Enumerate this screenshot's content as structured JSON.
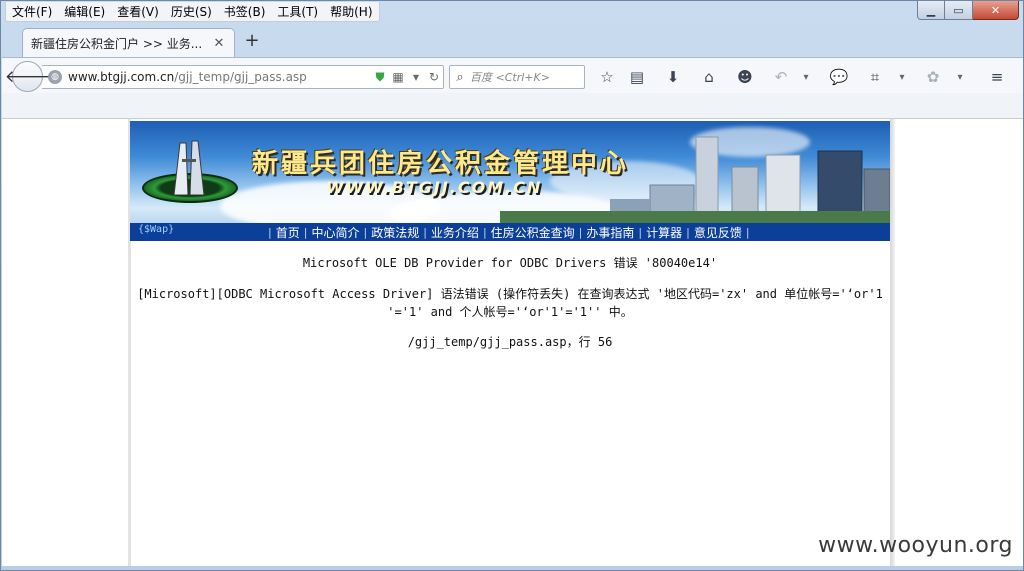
{
  "menu": {
    "items": [
      "文件(F)",
      "编辑(E)",
      "查看(V)",
      "历史(S)",
      "书签(B)",
      "工具(T)",
      "帮助(H)"
    ]
  },
  "window_controls": {
    "minimize": "▁",
    "maximize": "▭",
    "close": "✕"
  },
  "tabs": [
    {
      "title": "新疆住房公积金门户 >> 业务...",
      "close": "✕"
    }
  ],
  "new_tab_label": "+",
  "address": {
    "url_host": "www.btgjj.com.cn",
    "url_path": "/gjj_temp/gjj_pass.asp"
  },
  "search": {
    "placeholder": "百度 <Ctrl+K>"
  },
  "toolbar_icons": [
    "star-icon",
    "clipboard-icon",
    "download-icon",
    "home-icon",
    "smiley-icon",
    "undo-icon",
    "chat-icon",
    "crop-icon",
    "fortune-icon",
    "menu-icon"
  ],
  "site": {
    "title": "新疆兵团住房公积金管理中心",
    "domain": "WWW.BTGJJ.COM.CN",
    "wap_label": "{$Wap}",
    "nav": [
      "首页",
      "中心简介",
      "政策法规",
      "业务介绍",
      "住房公积金查询",
      "办事指南",
      "计算器",
      "意见反馈"
    ],
    "separator": "|"
  },
  "error": {
    "line1": "Microsoft OLE DB Provider for ODBC Drivers 错误 '80040e14'",
    "line2a": "[Microsoft][ODBC Microsoft Access Driver] 语法错误 (操作符丢失) 在查询表达式 '地区代码='zx' and 单位帐号='‘or'1",
    "line2b": "'='1' and 个人帐号='‘or'1'='1'' 中。",
    "line3": "/gjj_temp/gjj_pass.asp，行 56"
  },
  "watermark": "www.wooyun.org"
}
